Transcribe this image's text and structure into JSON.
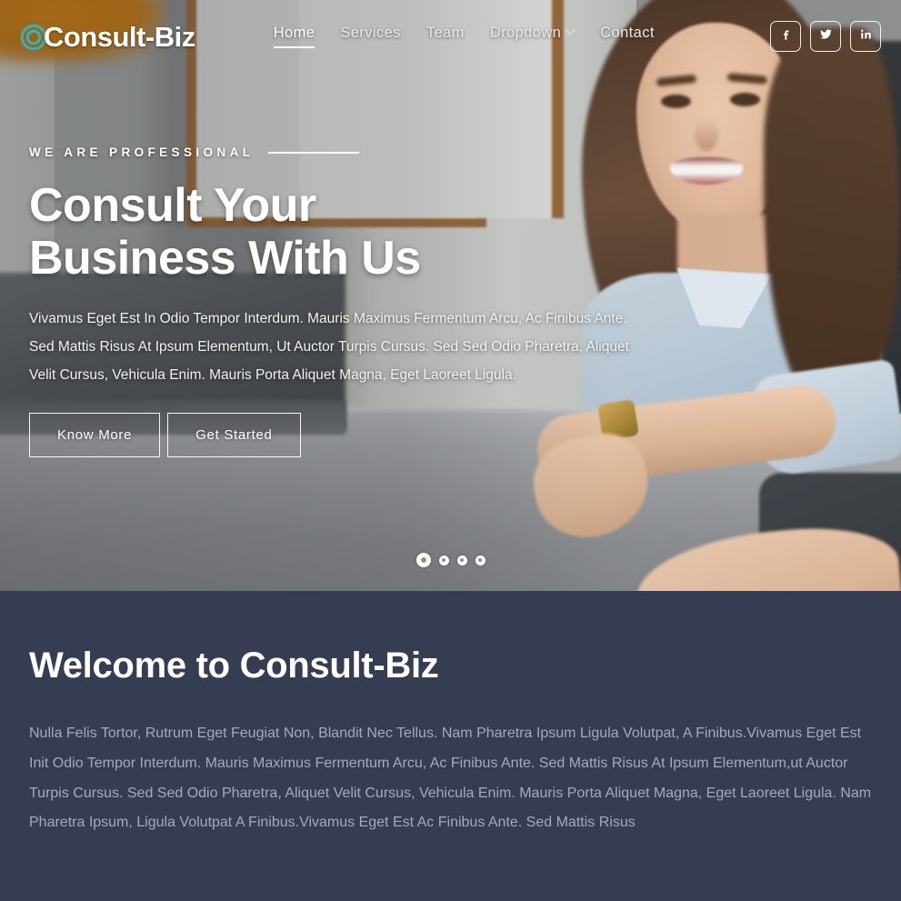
{
  "site": {
    "brand": "Consult-Biz",
    "brand_icon": "circle-c-logo-icon",
    "accent_color": "#2fb3bd",
    "dark_section_color": "#363c51"
  },
  "header": {
    "nav_items": [
      {
        "label": "Home",
        "active": true,
        "has_dropdown": false
      },
      {
        "label": "Services",
        "active": false,
        "has_dropdown": false
      },
      {
        "label": "Team",
        "active": false,
        "has_dropdown": false
      },
      {
        "label": "Dropdown",
        "active": false,
        "has_dropdown": true
      },
      {
        "label": "Contact",
        "active": false,
        "has_dropdown": false
      }
    ],
    "socials": [
      {
        "name": "facebook-icon",
        "label": "f"
      },
      {
        "name": "twitter-icon",
        "label": "t"
      },
      {
        "name": "linkedin-icon",
        "label": "in"
      }
    ]
  },
  "hero": {
    "eyebrow": "WE ARE PROFESSIONAL",
    "title_line1": "Consult Your",
    "title_line2": "Business With Us",
    "description": "Vivamus Eget Est In Odio Tempor Interdum. Mauris Maximus Fermentum Arcu, Ac Finibus Ante. Sed Mattis Risus At Ipsum Elementum, Ut Auctor Turpis Cursus. Sed Sed Odio Pharetra, Aliquet Velit Cursus, Vehicula Enim. Mauris Porta Aliquet Magna, Eget Laoreet Ligula.",
    "primary_button": "Know More",
    "secondary_button": "Get Started",
    "carousel": {
      "total_slides": 4,
      "active_slide": 1
    }
  },
  "welcome": {
    "title": "Welcome to Consult-Biz",
    "body": "Nulla Felis Tortor, Rutrum Eget Feugiat Non, Blandit Nec Tellus. Nam Pharetra Ipsum Ligula Volutpat, A Finibus.Vivamus Eget Est Init Odio Tempor Interdum. Mauris Maximus Fermentum Arcu, Ac Finibus Ante. Sed Mattis Risus At Ipsum Elementum,ut Auctor Turpis Cursus. Sed Sed Odio Pharetra, Aliquet Velit Cursus, Vehicula Enim. Mauris Porta Aliquet Magna, Eget Laoreet Ligula. Nam Pharetra Ipsum, Ligula Volutpat A Finibus.Vivamus Eget Est Ac Finibus Ante. Sed Mattis Risus"
  }
}
